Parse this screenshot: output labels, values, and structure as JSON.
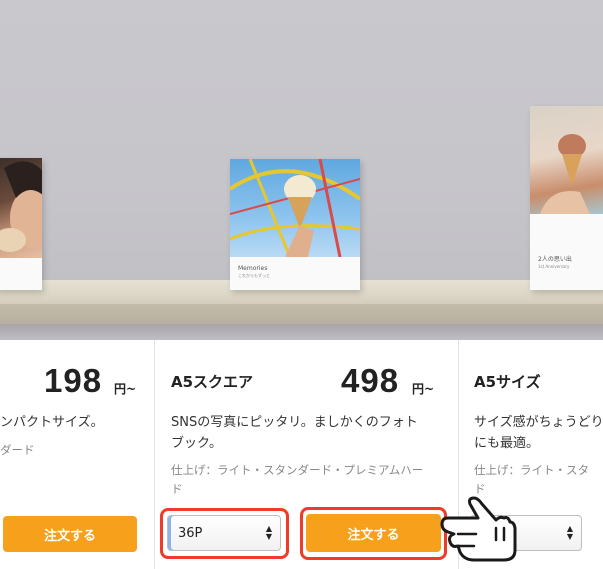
{
  "colors": {
    "accent": "#f7a01c",
    "highlight": "#f03a2a"
  },
  "books": {
    "center": {
      "title": "Memories",
      "subtitle": "これからもずっと"
    },
    "right": {
      "title": "2人の思い出",
      "subtitle": "1st Anniversary"
    }
  },
  "cards": [
    {
      "name": "",
      "price": "198",
      "price_unit": "円~",
      "description": "ンパクトサイズ。",
      "finish": "ダード",
      "order_label": "注文する"
    },
    {
      "name": "A5スクエア",
      "price": "498",
      "price_unit": "円~",
      "description_line1": "SNSの写真にピッタリ。ましかくのフォト",
      "description_line2": "ブック。",
      "finish_line1": "仕上げ：ライト・スタンダード・プレミアムハー",
      "finish_line2": "ド",
      "pages_selected": "36P",
      "order_label": "注文する"
    },
    {
      "name": "A5サイズ",
      "description_line1": "サイズ感がちょうどり",
      "description_line2": "にも最適。",
      "finish_line1": "仕上げ：ライト・スタ",
      "finish_line2": "ド",
      "pages_selected": ""
    }
  ]
}
